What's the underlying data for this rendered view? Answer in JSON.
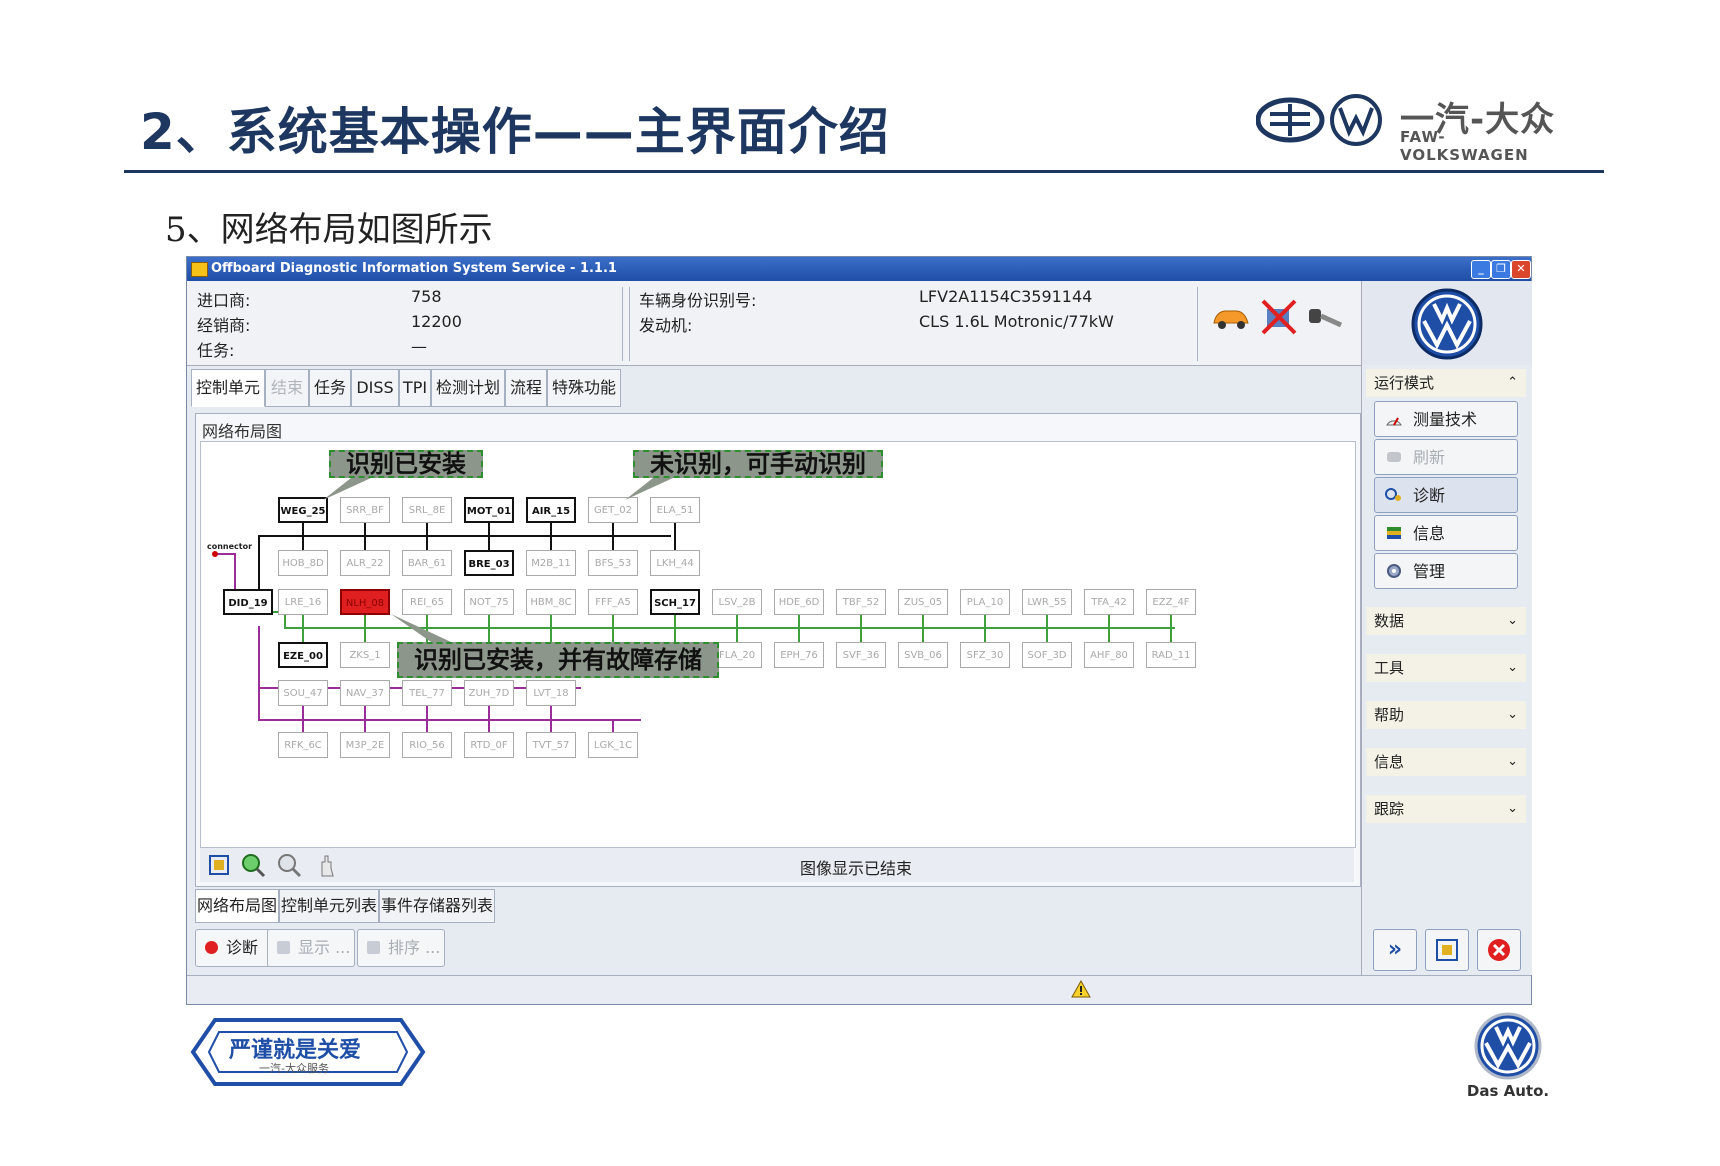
{
  "slide": {
    "title": "2、系统基本操作——主界面介绍",
    "subtitle": "5、网络布局如图所示",
    "brand_cn": "一汽-大众",
    "brand_en": "FAW-VOLKSWAGEN",
    "footer_slogan": "严谨就是关爱",
    "footer_sub": "一汽-大众服务",
    "das_auto": "Das Auto."
  },
  "window": {
    "title": "Offboard Diagnostic Information System Service - 1.1.1"
  },
  "info": {
    "importer_label": "进口商:",
    "importer_value": "758",
    "dealer_label": "经销商:",
    "dealer_value": "12200",
    "task_label": "任务:",
    "task_value": "—",
    "vin_label": "车辆身份识别号:",
    "vin_value": "LFV2A1154C3591144",
    "engine_label": "发动机:",
    "engine_value": "CLS 1.6L Motronic/77kW"
  },
  "tabs": [
    {
      "label": "控制单元",
      "state": "active"
    },
    {
      "label": "结束",
      "state": "disabled"
    },
    {
      "label": "任务",
      "state": "normal"
    },
    {
      "label": "DISS",
      "state": "normal"
    },
    {
      "label": "TPI",
      "state": "normal"
    },
    {
      "label": "检测计划",
      "state": "normal"
    },
    {
      "label": "流程",
      "state": "normal"
    },
    {
      "label": "特殊功能",
      "state": "normal"
    }
  ],
  "graph": {
    "panel_title": "网络布局图",
    "status": "图像显示已结束",
    "connector_label": "connector",
    "callouts": {
      "installed": "识别已安装",
      "unrecognized": "未识别，可手动识别",
      "fault": "识别已安装，并有故障存储"
    },
    "nodes": {
      "did": "DID_19",
      "top": [
        "WEG_25",
        "SRR_BF",
        "SRL_8E",
        "MOT_01",
        "AIR_15",
        "GET_02",
        "ELA_51"
      ],
      "second": [
        "HOB_8D",
        "ALR_22",
        "BAR_61",
        "BRE_03",
        "M2B_11",
        "BFS_53",
        "LKH_44"
      ],
      "green_top": [
        "LRE_16",
        "NLH_08",
        "REI_65",
        "NOT_75",
        "HBM_8C",
        "FFF_A5",
        "SCH_17",
        "LSV_2B",
        "HDE_6D",
        "TBF_52",
        "ZUS_05",
        "PLA_10",
        "LWR_55",
        "TFA_42",
        "EZZ_4F"
      ],
      "green_bottom": [
        "EZE_00",
        "ZKS_1",
        "FLA_20",
        "EPH_76",
        "SVF_36",
        "SVB_06",
        "SFZ_30",
        "SOF_3D",
        "AHF_80",
        "RAD_11"
      ],
      "purple_mid": [
        "SOU_47",
        "NAV_37",
        "TEL_77",
        "ZUH_7D",
        "LVT_18"
      ],
      "purple_bottom": [
        "RFK_6C",
        "M3P_2E",
        "RIO_56",
        "RTD_0F",
        "TVT_57",
        "LGK_1C"
      ]
    }
  },
  "bottom_tabs": [
    "网络布局图",
    "控制单元列表",
    "事件存储器列表"
  ],
  "actions": {
    "diagnose": "诊断",
    "display": "显示 ...",
    "sort": "排序 ..."
  },
  "right_panel": {
    "mode_header": "运行模式",
    "buttons": [
      "测量技术",
      "刷新",
      "诊断",
      "信息",
      "管理"
    ],
    "sections": [
      "数据",
      "工具",
      "帮助",
      "信息",
      "跟踪"
    ]
  },
  "colors": {
    "title": "#1d3760",
    "bus_black": "#111111",
    "bus_green": "#3da03d",
    "bus_purple": "#9a2d9a",
    "fault": "#e02020",
    "callout_bg": "#8d968a",
    "callout_border": "#2f8e2f"
  }
}
